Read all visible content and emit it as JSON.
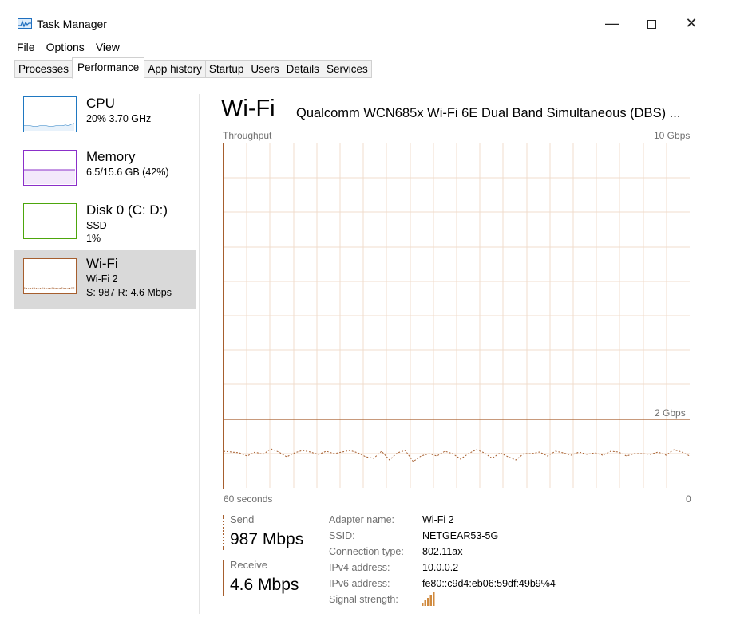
{
  "window": {
    "title": "Task Manager",
    "minimize_glyph": "—",
    "close_glyph": "✕"
  },
  "menu": [
    "File",
    "Options",
    "View"
  ],
  "tabs": [
    "Processes",
    "Performance",
    "App history",
    "Startup",
    "Users",
    "Details",
    "Services"
  ],
  "active_tab": "Performance",
  "sidebar": {
    "items": [
      {
        "name": "CPU",
        "sub1": "20%  3.70 GHz",
        "color": "#1f78c1"
      },
      {
        "name": "Memory",
        "sub1": "6.5/15.6 GB (42%)",
        "color": "#8b2fc9"
      },
      {
        "name": "Disk 0 (C: D:)",
        "sub1": "SSD",
        "sub2": "1%",
        "color": "#4da60c"
      },
      {
        "name": "Wi-Fi",
        "sub1": "Wi-Fi 2",
        "sub2": "S: 987  R: 4.6 Mbps",
        "color": "#a65e2e"
      }
    ],
    "selected": "Wi-Fi"
  },
  "main": {
    "title": "Wi-Fi",
    "adapter": "Qualcomm WCN685x Wi-Fi 6E Dual Band Simultaneous (DBS) ...",
    "graph": {
      "top_left": "Throughput",
      "top_right": "10 Gbps",
      "mid_right": "2 Gbps",
      "bottom_left": "60 seconds",
      "bottom_right": "0"
    }
  },
  "stats": {
    "send_label": "Send",
    "send_value": "987 Mbps",
    "receive_label": "Receive",
    "receive_value": "4.6 Mbps"
  },
  "details": [
    {
      "label": "Adapter name:",
      "value": "Wi-Fi 2"
    },
    {
      "label": "SSID:",
      "value": "NETGEAR53-5G"
    },
    {
      "label": "Connection type:",
      "value": "802.11ax"
    },
    {
      "label": "IPv4 address:",
      "value": "10.0.0.2"
    },
    {
      "label": "IPv6 address:",
      "value": "fe80::c9d4:eb06:59df:49b9%4"
    },
    {
      "label": "Signal strength:",
      "value": ""
    }
  ],
  "colors": {
    "wifi": "#a65e2e",
    "grid": "#f0dccc",
    "selected_bg": "#d9d9d9"
  },
  "icons": {
    "app": "task-manager-icon",
    "signal": "signal-strength-icon"
  }
}
